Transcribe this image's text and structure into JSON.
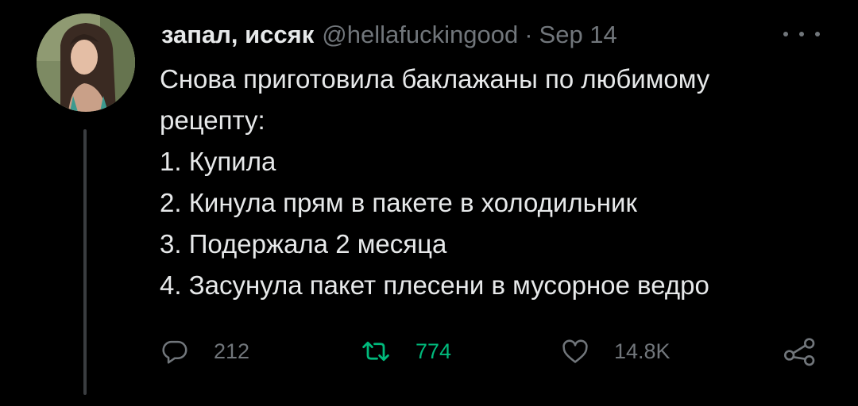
{
  "tweet": {
    "display_name": "запал, иссяк",
    "handle": "@hellafuckingood",
    "separator": "·",
    "time": "Sep 14",
    "text_lines": [
      "Снова приготовила баклажаны по любимому",
      "рецепту:",
      "1. Купила",
      "2. Кинула прям в пакете в холодильник",
      "3. Подержала 2 месяца",
      "4. Засунула пакет плесени в мусорное ведро"
    ],
    "stats": {
      "replies": "212",
      "retweets": "774",
      "likes": "14.8K"
    }
  },
  "icons": {
    "more": "more-horizontal-icon",
    "reply": "reply-bubble-icon",
    "retweet": "retweet-arrows-icon",
    "like": "heart-icon",
    "share": "share-icon"
  },
  "colors": {
    "background": "#000000",
    "text": "#e7e9ea",
    "muted": "#71767b",
    "retweeted": "#00ba7c",
    "thread_line": "#3a3d40"
  }
}
